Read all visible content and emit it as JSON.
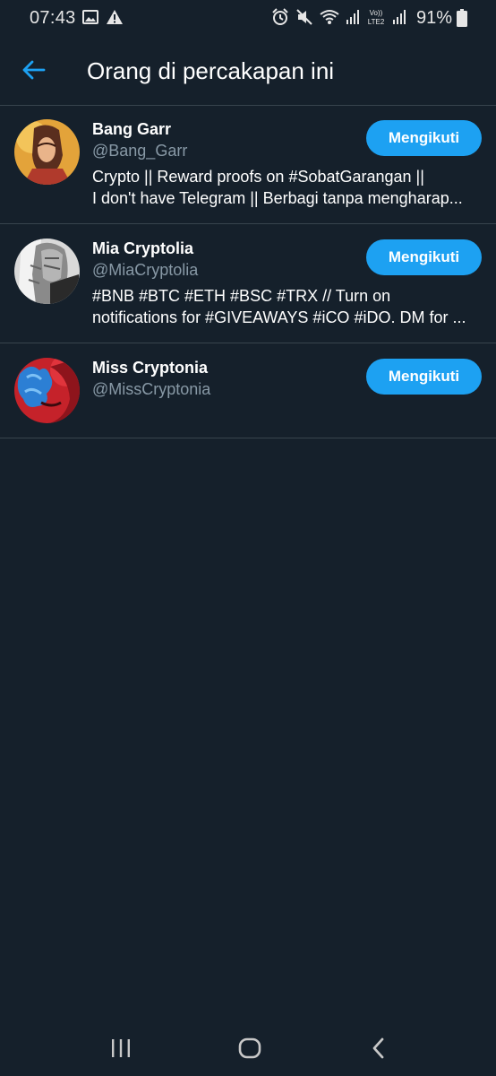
{
  "status_bar": {
    "time": "07:43",
    "battery": "91%",
    "left_icons": [
      "image-icon",
      "warning-icon"
    ],
    "right_icons": [
      "alarm-icon",
      "mute-icon",
      "wifi-icon",
      "signal-icon",
      "volte-icon",
      "signal-icon"
    ]
  },
  "header": {
    "title": "Orang di percakapan ini",
    "back_icon": "arrow-left-icon"
  },
  "colors": {
    "background": "#15202b",
    "accent": "#1da1f2",
    "secondary_text": "#8899a6",
    "divider": "#38444d"
  },
  "users": [
    {
      "name": "Bang Garr",
      "handle": "@Bang_Garr",
      "bio_lines": [
        "Crypto || Reward proofs on #SobatGarangan ||",
        "I don't have Telegram || Berbagi tanpa mengharap..."
      ],
      "follow_label": "Mengikuti"
    },
    {
      "name": "Mia Cryptolia",
      "handle": "@MiaCryptolia",
      "bio_lines": [
        "#BNB #BTC #ETH #BSC #TRX // Turn on",
        "notifications for #GIVEAWAYS #iCO #iDO. DM for ..."
      ],
      "follow_label": "Mengikuti"
    },
    {
      "name": "Miss Cryptonia",
      "handle": "@MissCryptonia",
      "bio_lines": [],
      "follow_label": "Mengikuti"
    }
  ],
  "nav_bar": {
    "items": [
      "recent-apps-icon",
      "home-icon",
      "back-icon"
    ]
  }
}
